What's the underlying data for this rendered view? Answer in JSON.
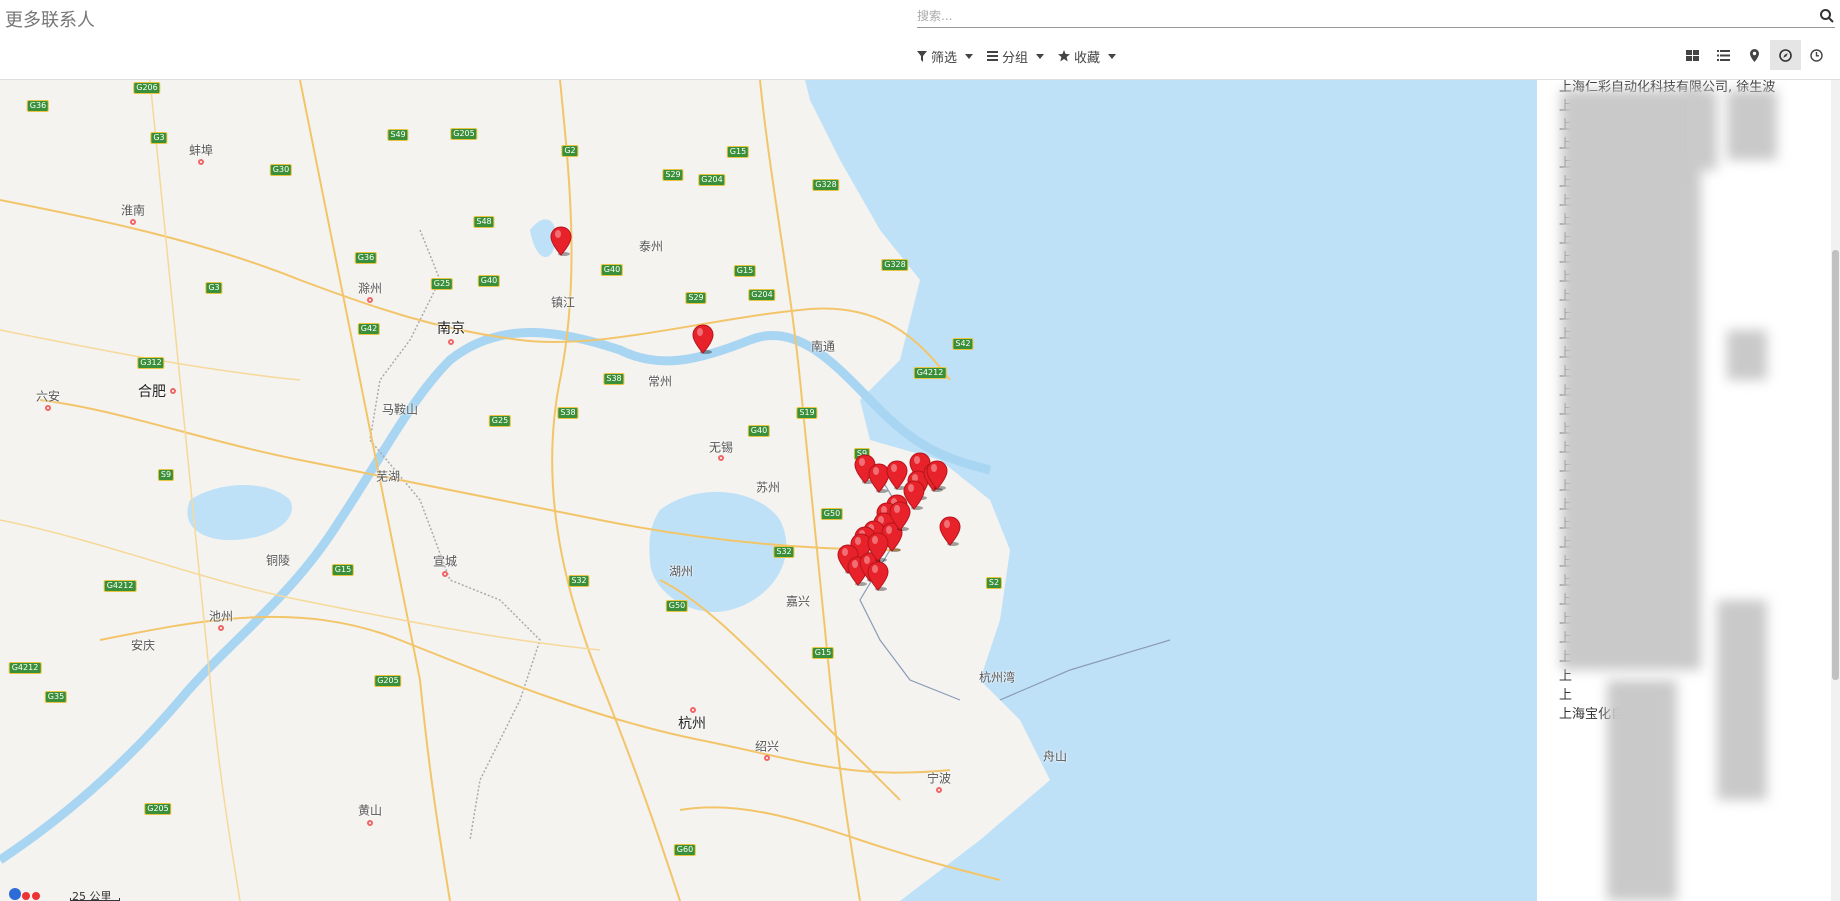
{
  "header": {
    "title": "更多联系人",
    "search_placeholder": "搜索..."
  },
  "filters": {
    "filter_label": "筛选",
    "group_label": "分组",
    "favorites_label": "收藏"
  },
  "view_switcher": {
    "items": [
      {
        "name": "kanban-view-icon",
        "active": false
      },
      {
        "name": "list-view-icon",
        "active": false
      },
      {
        "name": "map-pin-view-icon",
        "active": false
      },
      {
        "name": "map-view-icon",
        "active": true
      },
      {
        "name": "activity-view-icon",
        "active": false
      }
    ]
  },
  "map": {
    "cities": [
      {
        "label": "蚌埠"
      },
      {
        "label": "淮南"
      },
      {
        "label": "滁州"
      },
      {
        "label": "南京"
      },
      {
        "label": "镇江"
      },
      {
        "label": "泰州"
      },
      {
        "label": "南通"
      },
      {
        "label": "常州"
      },
      {
        "label": "合肥"
      },
      {
        "label": "六安"
      },
      {
        "label": "马鞍山"
      },
      {
        "label": "无锡"
      },
      {
        "label": "苏州"
      },
      {
        "label": "芜湖"
      },
      {
        "label": "宣城"
      },
      {
        "label": "铜陵"
      },
      {
        "label": "湖州"
      },
      {
        "label": "嘉兴"
      },
      {
        "label": "池州"
      },
      {
        "label": "安庆"
      },
      {
        "label": "杭州湾"
      },
      {
        "label": "杭州"
      },
      {
        "label": "绍兴"
      },
      {
        "label": "舟山"
      },
      {
        "label": "宁波"
      },
      {
        "label": "黄山"
      }
    ],
    "road_shields": [
      "G206",
      "G36",
      "G3",
      "S49",
      "G205",
      "G2",
      "G15",
      "G328",
      "S29",
      "G204",
      "S48",
      "G30",
      "G36",
      "G25",
      "G40",
      "G40",
      "S29",
      "G204",
      "G15",
      "G328",
      "G3",
      "S42",
      "G25",
      "G42",
      "G312",
      "S38",
      "S38",
      "S19",
      "G40",
      "G4212",
      "S9",
      "S9",
      "G50",
      "S32",
      "G15",
      "G4212",
      "S32",
      "G50",
      "S2",
      "G205",
      "G35",
      "G4212",
      "G15",
      "G205",
      "G60"
    ],
    "scale_label": "25 公里"
  },
  "contacts": {
    "visible_rows": [
      "上海仁彩自动化科技有限公司, 徐生波",
      "上",
      "上",
      "上",
      "上",
      "上",
      "上",
      "上",
      "上",
      "上",
      "上",
      "上",
      "上",
      "上",
      "上",
      "上",
      "上",
      "上",
      "上",
      "上",
      "上",
      "上",
      "上",
      "上",
      "上",
      "上",
      "上",
      "上",
      "上",
      "上",
      "上",
      "上",
      "上",
      "上海宝化自动化"
    ]
  }
}
